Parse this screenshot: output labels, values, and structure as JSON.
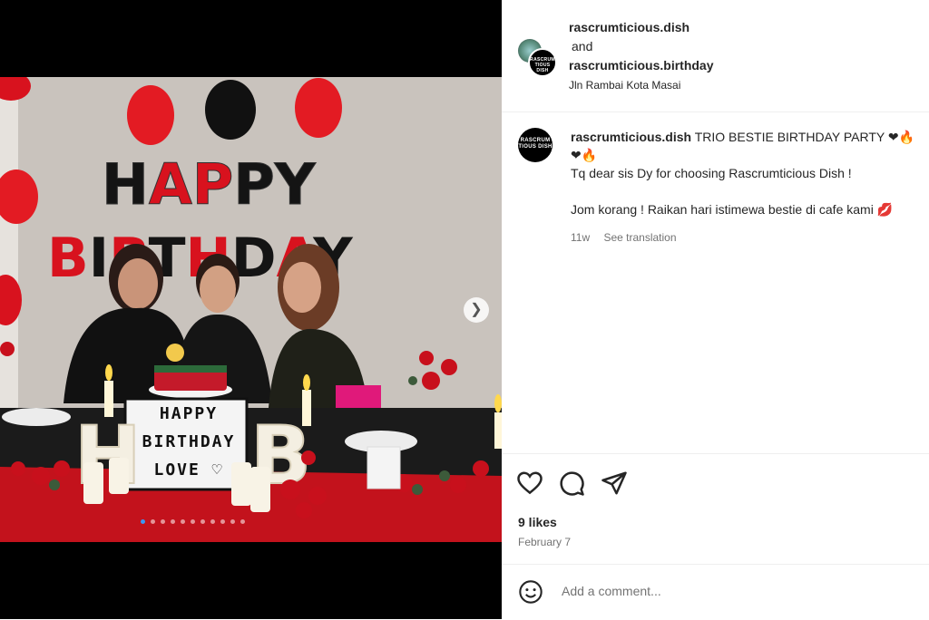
{
  "post": {
    "author1": "rascrumticious.dish",
    "joiner": "and",
    "author2": "rascrumticious.birthday",
    "location": "Jln Rambai Kota Masai",
    "avatar_logo": "RASCRUM TIOUS DISH"
  },
  "photo": {
    "lightbox_lines": [
      "HAPPY",
      "BIRTHDAY",
      "LOVE ♡"
    ],
    "balloon_line1": "HAPPY",
    "balloon_line2": "BIRTHDAY",
    "slide_count": 11,
    "active_slide": 1
  },
  "caption": {
    "username": "rascrumticious.dish",
    "line1": "TRIO BESTIE BIRTHDAY PARTY",
    "line1_emoji": "❤🔥",
    "line2_emoji": "❤🔥",
    "line3": "Tq dear sis Dy for choosing Rascrumticious Dish !",
    "line4": "Jom korang ! Raikan hari istimewa bestie di cafe kami 💋",
    "age": "11w",
    "see_translation": "See translation"
  },
  "stats": {
    "likes": "9 likes",
    "date": "February 7"
  },
  "comment": {
    "placeholder": "Add a comment..."
  },
  "icons": {
    "like": "heart-icon",
    "comment": "comment-bubble-icon",
    "share": "paper-plane-icon",
    "next": "chevron-right-icon",
    "emoji": "smiley-icon"
  },
  "colors": {
    "accent_dot": "#3b97f5",
    "text": "#262626",
    "muted": "#737373"
  }
}
